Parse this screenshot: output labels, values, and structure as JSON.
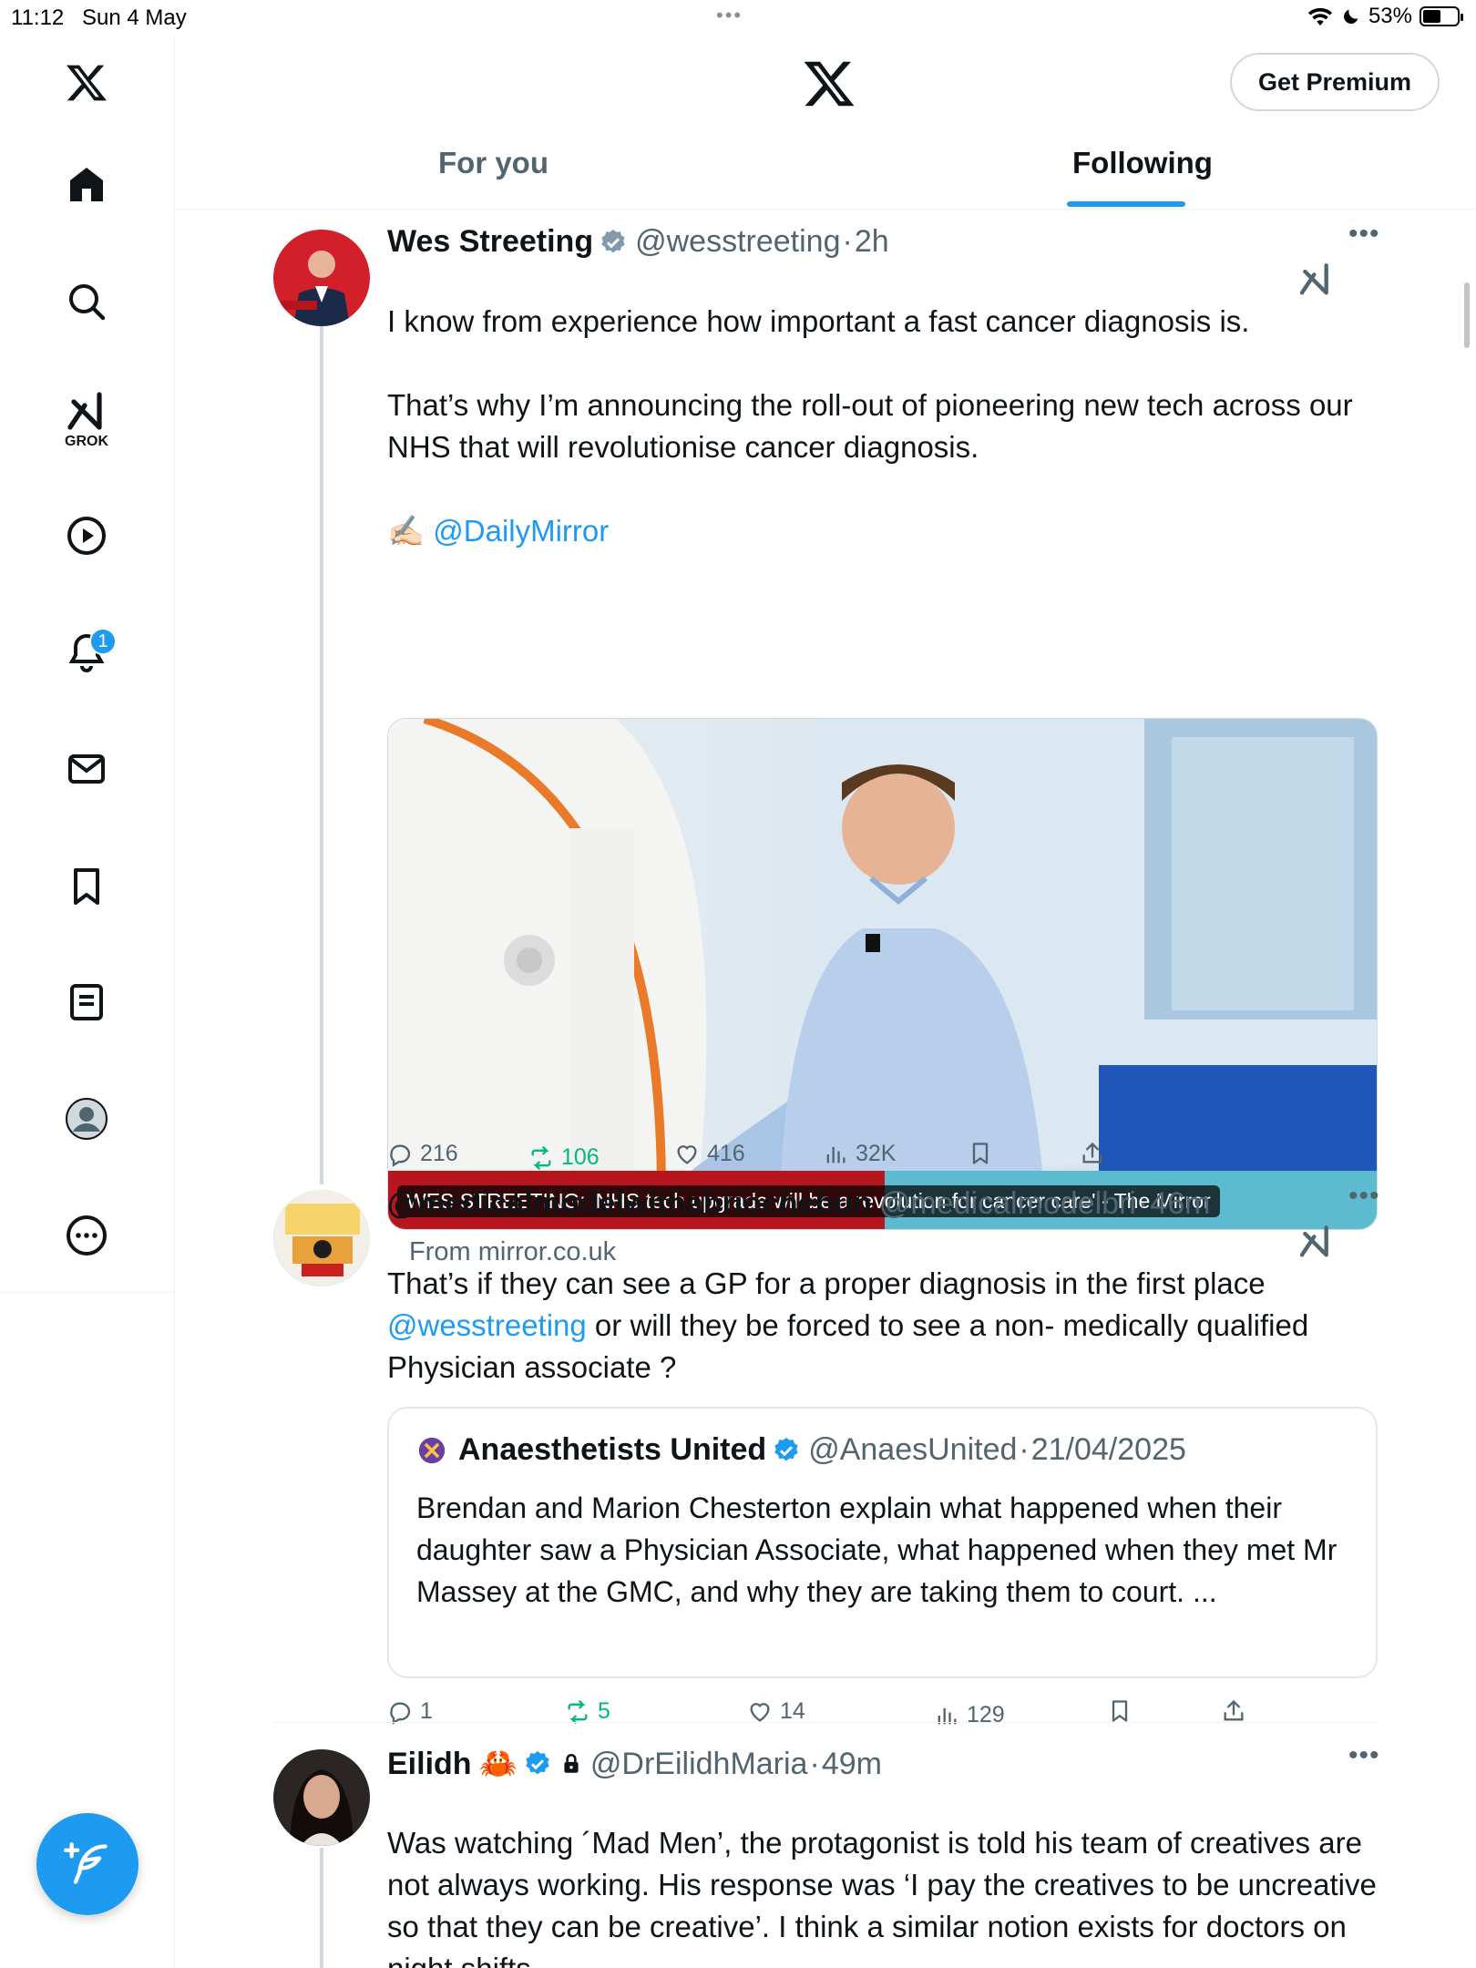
{
  "status_bar": {
    "time": "11:12",
    "date": "Sun 4 May",
    "battery": "53%",
    "battery_level": 0.53
  },
  "sidebar": {
    "grok_label": "GROK",
    "notification_count": "1"
  },
  "header": {
    "premium_label": "Get Premium",
    "tabs": [
      {
        "label": "For you",
        "active": false
      },
      {
        "label": "Following",
        "active": true
      }
    ]
  },
  "tweets": [
    {
      "name": "Wes Streeting",
      "handle": "@wesstreeting",
      "sep": "·",
      "time": "2h",
      "text_line1": "I know from experience how important a fast cancer diagnosis is.",
      "text_line2": "That’s why I’m announcing the roll-out of pioneering new tech across our NHS that will revolutionise cancer diagnosis.",
      "emoji": "✍🏻",
      "mention": "@DailyMirror",
      "media_caption": "WES STREETING: 'NHS tech upgrade will be a revolution for cancer care' - The Mirror",
      "from_source": "From mirror.co.uk",
      "stats": {
        "replies": "216",
        "reposts": "106",
        "likes": "416",
        "views": "32K"
      }
    },
    {
      "name": "@medicalmodelwithabriochebun",
      "handle": "@medicalmodelbri",
      "sep": "·",
      "time": "46m",
      "text_part1": "That’s if they can see a GP for a proper diagnosis in the first place",
      "mention": "@wesstreeting",
      "text_part2": " or will they be forced to see a non- medically qualified Physician associate ?",
      "quote": {
        "name": "Anaesthetists United",
        "handle": "@AnaesUnited",
        "sep": "·",
        "date": "21/04/2025",
        "text": "Brendan and Marion Chesterton  explain what happened when their daughter saw a Physician Associate, what happened when they met Mr Massey at the GMC, and why they are taking them to court. ..."
      },
      "stats": {
        "replies": "1",
        "reposts": "5",
        "likes": "14",
        "views": "129"
      }
    },
    {
      "name": "Eilidh",
      "emoji": "🦀",
      "handle": "@DrEilidhMaria",
      "sep": "·",
      "time": "49m",
      "text": "Was watching ´Mad Men’, the protagonist is told his team of creatives are not always working. His response was ‘I pay the creatives to be uncreative so that they can be creative’. I think a similar notion exists for doctors on night shifts."
    }
  ],
  "colors": {
    "accent": "#1d9bf0",
    "repost_green": "#00ba7c",
    "muted_text": "#536471"
  }
}
